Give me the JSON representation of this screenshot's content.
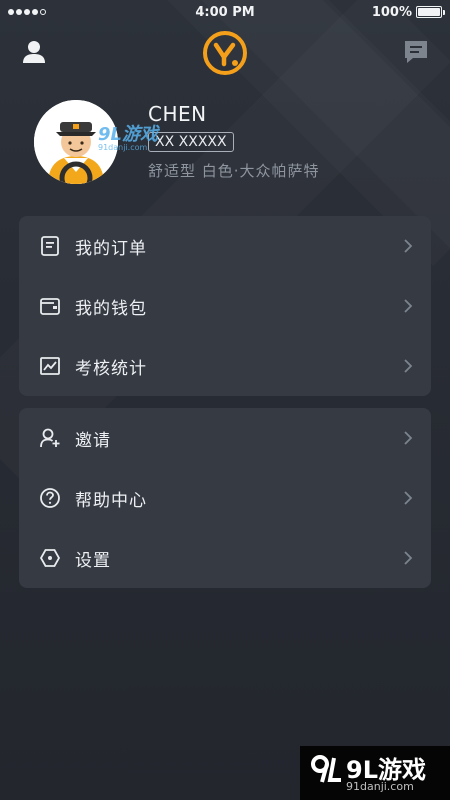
{
  "status_bar": {
    "time": "4:00 PM",
    "battery": "100%",
    "signal_bars": 4
  },
  "top_nav": {
    "left_icon": "profile-icon",
    "logo_letter": "y.",
    "right_icon": "message-icon"
  },
  "user": {
    "name": "CHEN",
    "plate": "XX XXXXX",
    "car_info": "舒适型 白色·大众帕萨特",
    "avatar_icon": "driver-avatar-icon"
  },
  "menu_group_1": [
    {
      "label": "我的订单",
      "icon": "order-icon"
    },
    {
      "label": "我的钱包",
      "icon": "wallet-icon"
    },
    {
      "label": "考核统计",
      "icon": "chart-icon"
    }
  ],
  "menu_group_2": [
    {
      "label": "邀请",
      "icon": "invite-user-icon"
    },
    {
      "label": "帮助中心",
      "icon": "help-icon"
    },
    {
      "label": "设置",
      "icon": "settings-icon"
    }
  ],
  "watermark": {
    "small_text": "9L游戏",
    "small_sub": "91danji.com",
    "big_text": "9L游戏",
    "url": "91danji.com"
  },
  "colors": {
    "background": "#272b33",
    "card": "#353a43",
    "accent": "#f5a01a",
    "text_secondary": "#8e959f"
  }
}
